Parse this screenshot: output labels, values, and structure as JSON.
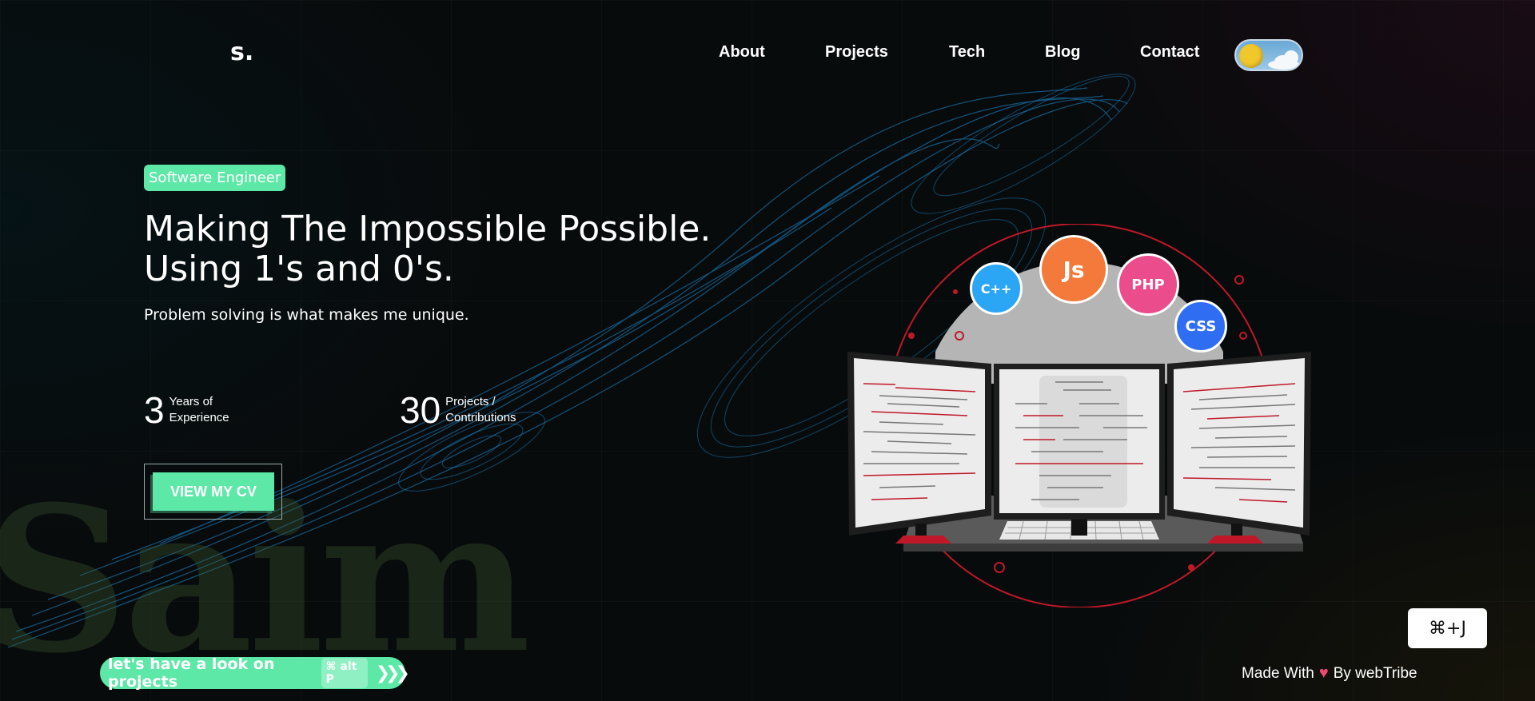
{
  "header": {
    "logo": "s.",
    "nav": [
      {
        "label": "About"
      },
      {
        "label": "Projects"
      },
      {
        "label": "Tech"
      },
      {
        "label": "Blog"
      },
      {
        "label": "Contact"
      }
    ],
    "theme_toggle_icon": "sun-cloud-toggle"
  },
  "hero": {
    "badge": "Software Engineer",
    "title": "Making The Impossible Possible. Using 1's and 0's.",
    "subtitle": "Problem solving is what makes me unique.",
    "stats": [
      {
        "value": "3",
        "label_line1": "Years of",
        "label_line2": "Experience"
      },
      {
        "value": "30",
        "label_line1": "Projects /",
        "label_line2": "Contributions"
      }
    ],
    "cv_button": "VIEW MY CV",
    "watermark": "Saim"
  },
  "illustration": {
    "tech_bubbles": [
      {
        "label": "C++",
        "color": "#2aa6f5"
      },
      {
        "label": "Js",
        "color": "#f47a3c"
      },
      {
        "label": "PHP",
        "color": "#ea4c8c"
      },
      {
        "label": "CSS",
        "color": "#2f6ef2"
      }
    ]
  },
  "bottom": {
    "projects_pill": "let's have a look on projects",
    "projects_shortcut": "⌘ alt P",
    "chevrons": "❯❯❯",
    "command_shortcut": "⌘+J",
    "made_with_prefix": "Made With",
    "heart": "♥",
    "made_with_suffix": "By webTribe"
  },
  "colors": {
    "accent": "#5ee8a8",
    "background": "#080b0c",
    "swirl": "#1c8fd6"
  }
}
